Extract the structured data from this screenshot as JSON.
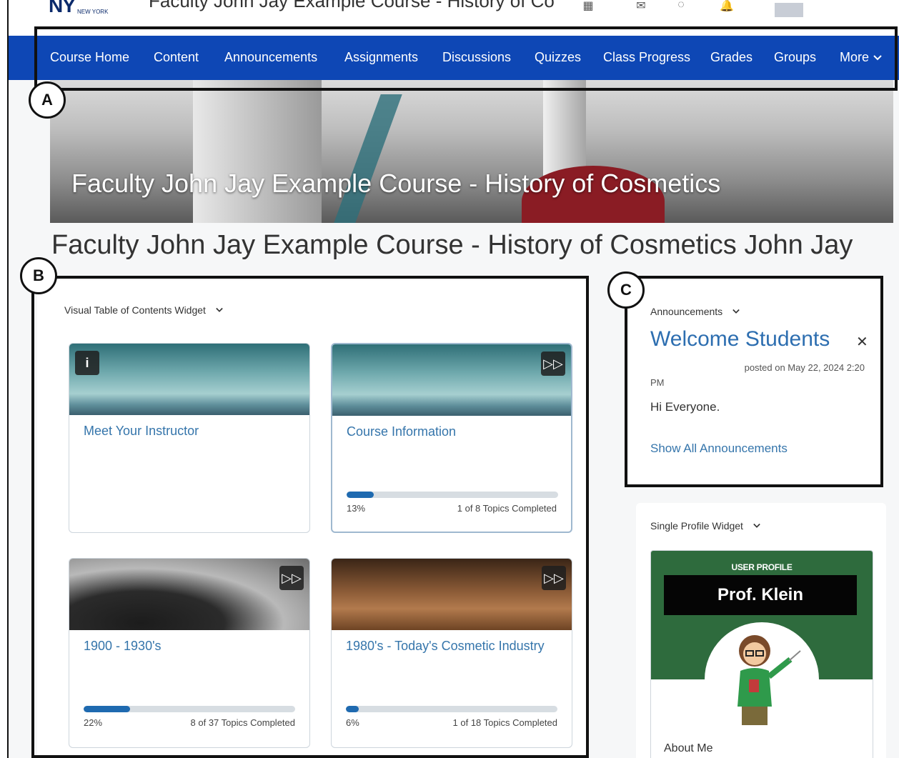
{
  "minibar": {
    "logo": "NY",
    "logo_sub": "NEW YORK",
    "breadcrumb": "Faculty John Jay Example Course - History of Co",
    "icons": [
      "apps-icon",
      "mail-icon",
      "chat-icon",
      "bell-icon"
    ]
  },
  "nav": {
    "items": [
      "Course Home",
      "Content",
      "Announcements",
      "Assignments",
      "Discussions",
      "Quizzes",
      "Class Progress",
      "Grades",
      "Groups"
    ],
    "more": "More"
  },
  "annotations": {
    "a": "A",
    "b": "B",
    "c": "C"
  },
  "banner": {
    "title": "Faculty John Jay Example Course - History of Cosmetics"
  },
  "page": {
    "title": "Faculty John Jay Example Course - History of Cosmetics John Jay"
  },
  "toc": {
    "header": "Visual Table of Contents Widget",
    "cards": [
      {
        "title": "Meet Your Instructor",
        "badge": "i",
        "badge_icon": "info-icon"
      },
      {
        "title": "Course Information",
        "badge": "▷▷",
        "badge_icon": "fast-forward-icon",
        "percent_label": "13%",
        "progress": 0.13,
        "count_label": "1 of 8 Topics Completed"
      },
      {
        "title": "1900 - 1930's",
        "badge": "▷▷",
        "badge_icon": "fast-forward-icon",
        "percent_label": "22%",
        "progress": 0.22,
        "count_label": "8 of 37 Topics Completed"
      },
      {
        "title": "1980's - Today's Cosmetic Industry",
        "badge": "▷▷",
        "badge_icon": "fast-forward-icon",
        "percent_label": "6%",
        "progress": 0.06,
        "count_label": "1 of 18 Topics Completed"
      }
    ]
  },
  "announcements": {
    "header": "Announcements",
    "title": "Welcome Students",
    "posted": "posted on May 22, 2024 2:20",
    "posted_pm": "PM",
    "body": "Hi Everyone.",
    "link": "Show All Announcements"
  },
  "profile": {
    "header": "Single Profile Widget",
    "caption": "USER PROFILE",
    "name": "Prof. Klein",
    "about": "About Me"
  },
  "colors": {
    "nav": "#0e47b5",
    "link": "#3575ab",
    "progress": "#1f6ab0",
    "profile_green": "#2e6b3d"
  }
}
